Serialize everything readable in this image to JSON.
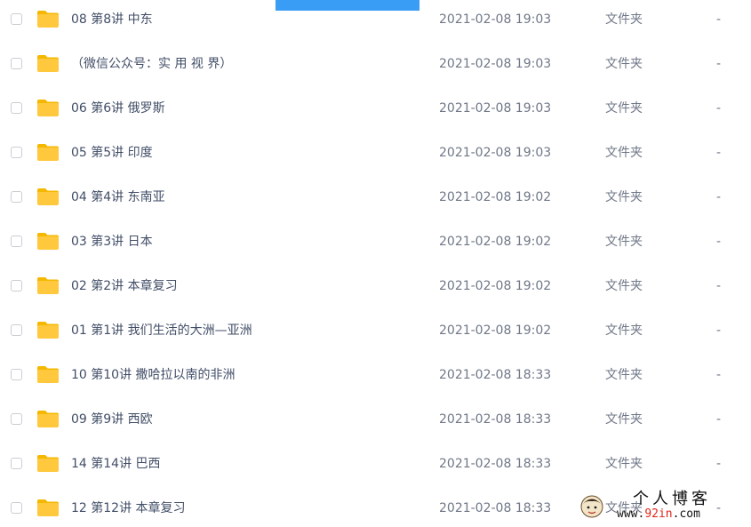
{
  "colors": {
    "top_bar": "#3a9df5",
    "folder": "#ffc83d",
    "folder_tab": "#f5b800",
    "text_primary": "#424e67",
    "text_secondary": "#6f7787"
  },
  "files": [
    {
      "name": "08 第8讲 中东",
      "date": "2021-02-08 19:03",
      "type": "文件夹",
      "size": "-",
      "icon": "folder-icon"
    },
    {
      "name": "（微信公众号：实 用 视 界）",
      "date": "2021-02-08 19:03",
      "type": "文件夹",
      "size": "-",
      "icon": "folder-icon"
    },
    {
      "name": "06 第6讲 俄罗斯",
      "date": "2021-02-08 19:03",
      "type": "文件夹",
      "size": "-",
      "icon": "folder-icon"
    },
    {
      "name": "05 第5讲 印度",
      "date": "2021-02-08 19:03",
      "type": "文件夹",
      "size": "-",
      "icon": "folder-icon"
    },
    {
      "name": "04 第4讲 东南亚",
      "date": "2021-02-08 19:02",
      "type": "文件夹",
      "size": "-",
      "icon": "folder-icon"
    },
    {
      "name": "03 第3讲 日本",
      "date": "2021-02-08 19:02",
      "type": "文件夹",
      "size": "-",
      "icon": "folder-icon"
    },
    {
      "name": "02 第2讲 本章复习",
      "date": "2021-02-08 19:02",
      "type": "文件夹",
      "size": "-",
      "icon": "folder-icon"
    },
    {
      "name": "01 第1讲 我们生活的大洲—亚洲",
      "date": "2021-02-08 19:02",
      "type": "文件夹",
      "size": "-",
      "icon": "folder-icon"
    },
    {
      "name": "10 第10讲 撒哈拉以南的非洲",
      "date": "2021-02-08 18:33",
      "type": "文件夹",
      "size": "-",
      "icon": "folder-icon"
    },
    {
      "name": "09 第9讲 西欧",
      "date": "2021-02-08 18:33",
      "type": "文件夹",
      "size": "-",
      "icon": "folder-icon"
    },
    {
      "name": "14 第14讲 巴西",
      "date": "2021-02-08 18:33",
      "type": "文件夹",
      "size": "-",
      "icon": "folder-icon"
    },
    {
      "name": "12 第12讲 本章复习",
      "date": "2021-02-08 18:33",
      "type": "文件夹",
      "size": "-",
      "icon": "folder-icon"
    }
  ],
  "watermark": {
    "title": "个人博客",
    "url_prefix": "www.",
    "url_highlight": "92in",
    "url_suffix": ".com"
  }
}
